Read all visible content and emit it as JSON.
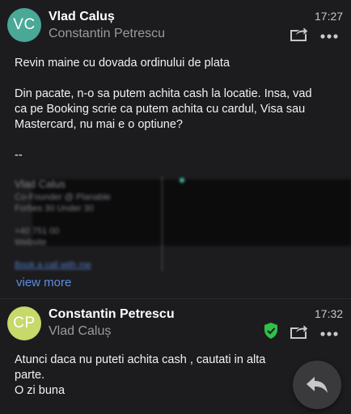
{
  "messages": [
    {
      "avatar_initials": "VC",
      "avatar_color": "#4aa897",
      "sender": "Vlad Caluș",
      "recipient": "Constantin Petrescu",
      "time": "17:27",
      "body": [
        "Revin maine cu dovada ordinului de plata",
        "Din pacate, n-o sa putem achita cash la locatie. Insa, vad ca pe Booking scrie ca putem achita cu cardul, Visa sau Mastercard, nu mai e o optiune?",
        "--"
      ],
      "signature": {
        "name": "Vlad Calus",
        "role": "Co-Founder @ Planable",
        "company": "Forbes 30 Under 30",
        "phone": "+40 751 00",
        "site": "Website",
        "book_link": "Book a call with me"
      },
      "view_more": "view more"
    },
    {
      "avatar_initials": "CP",
      "avatar_color": "#c6d96a",
      "sender": "Constantin Petrescu",
      "recipient": "Vlad Caluș",
      "time": "17:32",
      "body": [
        "Atunci daca nu puteti achita cash , cautati in alta parte.",
        "O zi buna"
      ]
    }
  ],
  "colors": {
    "background": "#1c1c1e",
    "verified_badge": "#2fbf4a",
    "link": "#5b8ee6"
  },
  "icons": {
    "forward": "forward-icon",
    "more": "more-icon",
    "verified": "shield-check-icon",
    "reply_fab": "reply-icon"
  }
}
